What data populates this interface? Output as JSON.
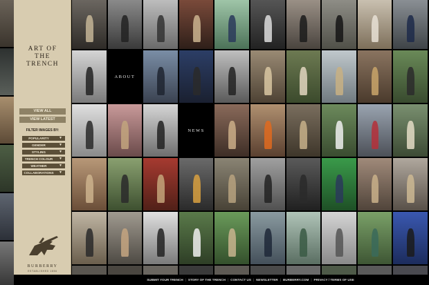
{
  "sidebar": {
    "title_lines": [
      "ART OF",
      "THE",
      "TRENCH"
    ],
    "view_all": "VIEW ALL",
    "view_latest": "VIEW LATEST",
    "filter_label": "FILTER IMAGES BY:",
    "filters": [
      "POPULARITY",
      "GENDER",
      "STYLING",
      "TRENCH COLOUR",
      "WEATHER",
      "COLLABORATIONS"
    ],
    "brand": "BURBERRY",
    "brand_sub": "ESTABLISHED 1856"
  },
  "grid": {
    "about_label": "ABOUT",
    "news_label": "NEWS"
  },
  "footer": {
    "links": [
      "SUBMIT YOUR TRENCH",
      "STORY OF THE TRENCH",
      "CONTACT US",
      "NEWSLETTER",
      "BURBERRY.COM",
      "PRIVACY / TERMS OF USE"
    ]
  }
}
